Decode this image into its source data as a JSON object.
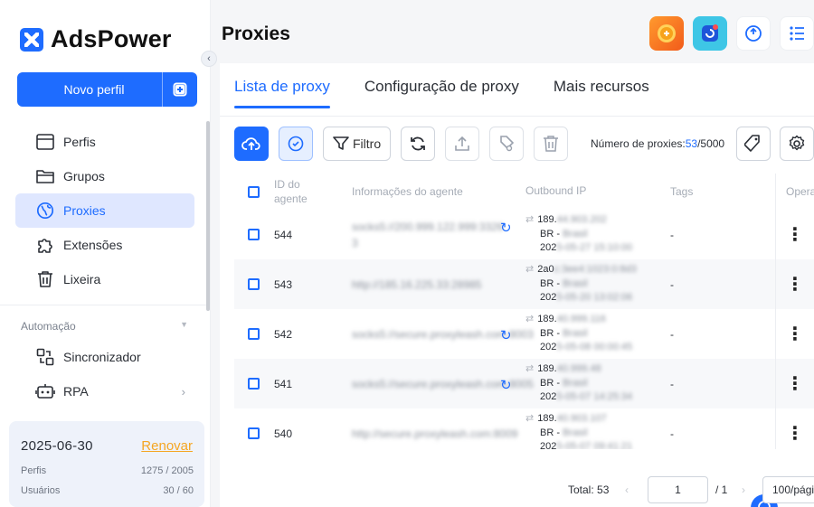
{
  "app": {
    "logo_text": "AdsPower"
  },
  "sidebar": {
    "new_profile_label": "Novo perfil",
    "nav": [
      {
        "label": "Perfis",
        "icon": "browser-window-icon"
      },
      {
        "label": "Grupos",
        "icon": "folder-icon"
      },
      {
        "label": "Proxies",
        "icon": "proxy-globe-icon",
        "active": true
      },
      {
        "label": "Extensões",
        "icon": "puzzle-icon"
      },
      {
        "label": "Lixeira",
        "icon": "trash-icon"
      }
    ],
    "automation_section": "Automação",
    "automation": [
      {
        "label": "Sincronizador",
        "icon": "sync-icon"
      },
      {
        "label": "RPA",
        "icon": "robot-icon"
      }
    ],
    "plan": {
      "date": "2025-06-30",
      "renew_label": "Renovar",
      "profiles_label": "Perfis",
      "profiles_value": "1275 / 2005",
      "users_label": "Usuários",
      "users_value": "30 / 60"
    }
  },
  "main": {
    "page_title": "Proxies",
    "tabs": [
      {
        "label": "Lista de proxy",
        "active": true
      },
      {
        "label": "Configuração de proxy"
      },
      {
        "label": "Mais recursos"
      }
    ],
    "toolbar": {
      "filter_label": "Filtro",
      "count_label": "Número de proxies:",
      "count_current": "53",
      "count_total": "/5000"
    },
    "table": {
      "headers": {
        "id": "ID do agente",
        "info": "Informações do agente",
        "outbound": "Outbound IP",
        "tags": "Tags",
        "op": "Opera"
      },
      "rows": [
        {
          "id": "544",
          "info": "socks5://200.999.122.999:3326 3",
          "ip": "189.",
          "ip_rest": "44.903.202",
          "country": "BR -",
          "country_rest": "Brasil",
          "date": "202",
          "date_rest": "5-05-27 15:10:00",
          "tags": "-",
          "refresh": true
        },
        {
          "id": "543",
          "info": "http://185.16.225.33:28985",
          "ip": "2a0",
          "ip_rest": "c:3ee4:1023:0:8d3",
          "country": "BR -",
          "country_rest": "Brasil",
          "date": "202",
          "date_rest": "5-05-20 13:02:06",
          "tags": "-",
          "refresh": false
        },
        {
          "id": "542",
          "info": "socks5://secure.proxyleash.com:8003",
          "ip": "189.",
          "ip_rest": "40.999.116",
          "country": "BR -",
          "country_rest": "Brasil",
          "date": "202",
          "date_rest": "5-05-08 00:00:45",
          "tags": "-",
          "refresh": true
        },
        {
          "id": "541",
          "info": "socks5://secure.proxyleash.com:8005",
          "ip": "189.",
          "ip_rest": "40.999.48",
          "country": "BR -",
          "country_rest": "Brasil",
          "date": "202",
          "date_rest": "5-05-07 14:25:34",
          "tags": "-",
          "refresh": true
        },
        {
          "id": "540",
          "info": "http://secure.proxyleash.com:8009",
          "ip": "189.",
          "ip_rest": "40.903.107",
          "country": "BR -",
          "country_rest": "Brasil",
          "date": "202",
          "date_rest": "5-05-07 09:41:21",
          "tags": "-",
          "refresh": false
        }
      ]
    },
    "pagination": {
      "total": "Total: 53",
      "page": "1",
      "pages": "/ 1",
      "per_page": "100/pági"
    }
  }
}
